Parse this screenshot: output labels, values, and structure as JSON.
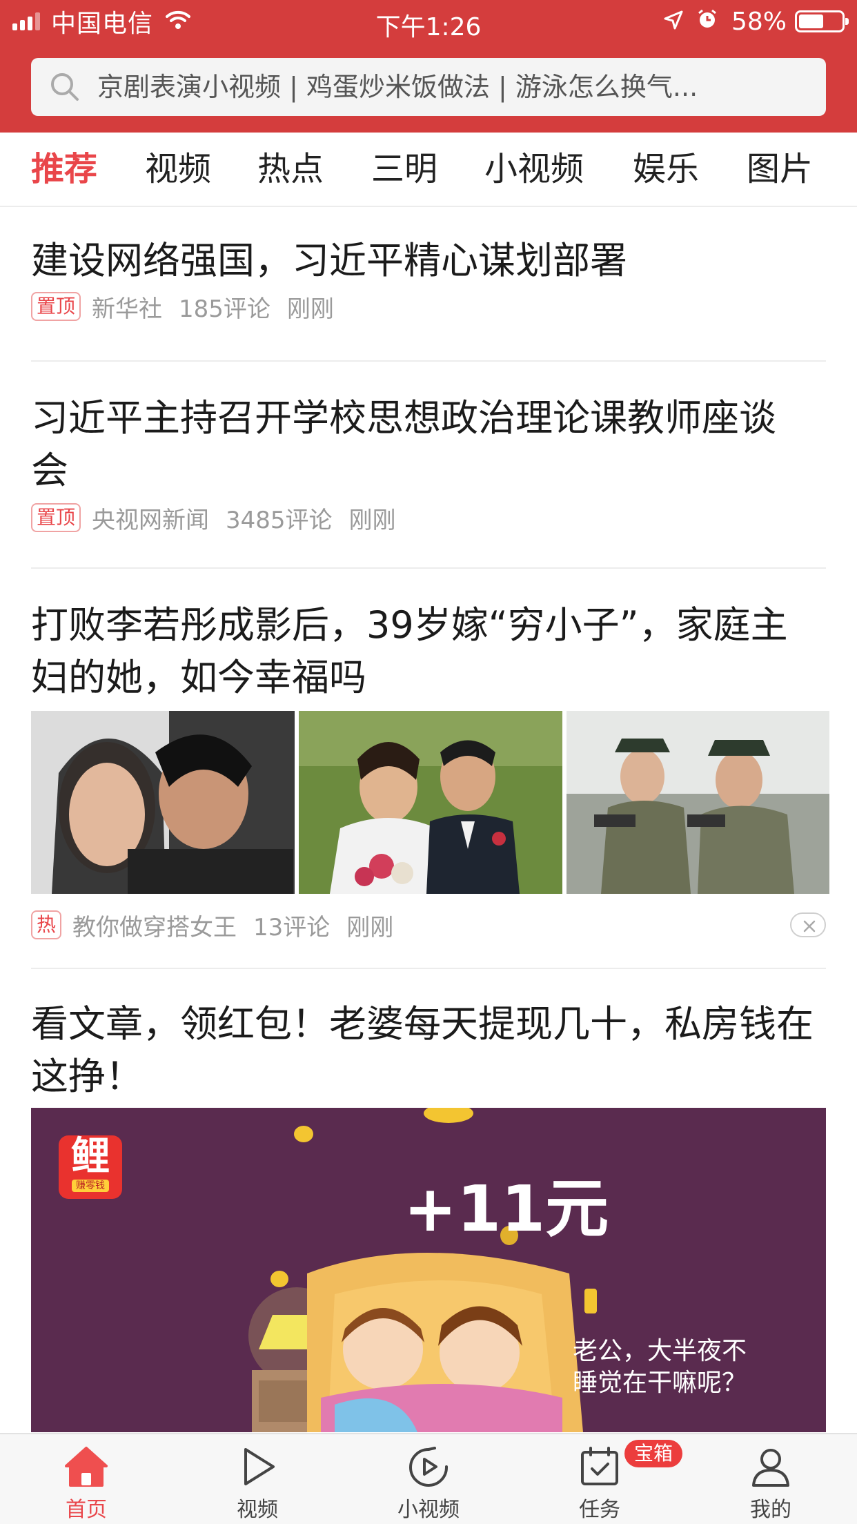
{
  "status_bar": {
    "carrier": "中国电信",
    "time": "下午1:26",
    "battery": "58%",
    "battery_level": 0.58
  },
  "search": {
    "placeholder": "京剧表演小视频 | 鸡蛋炒米饭做法 | 游泳怎么换气..."
  },
  "tabs": [
    {
      "label": "推荐",
      "active": true
    },
    {
      "label": "视频"
    },
    {
      "label": "热点"
    },
    {
      "label": "三明"
    },
    {
      "label": "小视频"
    },
    {
      "label": "娱乐"
    },
    {
      "label": "图片"
    }
  ],
  "feed": [
    {
      "title": "建设网络强国，习近平精心谋划部署",
      "tag": "置顶",
      "source": "新华社",
      "comments": "185评论",
      "time": "刚刚"
    },
    {
      "title": "习近平主持召开学校思想政治理论课教师座谈会",
      "tag": "置顶",
      "source": "央视网新闻",
      "comments": "3485评论",
      "time": "刚刚"
    },
    {
      "title": "打败李若彤成影后，39岁嫁“穷小子”，家庭主妇的她，如今幸福吗",
      "tag": "热",
      "source": "教你做穿搭女王",
      "comments": "13评论",
      "time": "刚刚"
    },
    {
      "title": "看文章，领红包！老婆每天提现几十，私房钱在这挣！",
      "banner_amount": "+11元",
      "banner_quote_1": "老公，大半夜不",
      "banner_quote_2": "睡觉在干嘛呢？",
      "brand_logo_char": "鲤",
      "brand_logo_sub": "赚零钱"
    }
  ],
  "bottom_nav": [
    {
      "label": "首页",
      "icon": "home-icon",
      "active": true
    },
    {
      "label": "视频",
      "icon": "play-icon"
    },
    {
      "label": "小视频",
      "icon": "short-video-icon"
    },
    {
      "label": "任务",
      "icon": "task-icon",
      "badge": "宝箱"
    },
    {
      "label": "我的",
      "icon": "profile-icon"
    }
  ],
  "colors": {
    "brand_red": "#d43d3d",
    "accent_red": "#e9464a",
    "banner_purple": "#5a2b4f"
  }
}
